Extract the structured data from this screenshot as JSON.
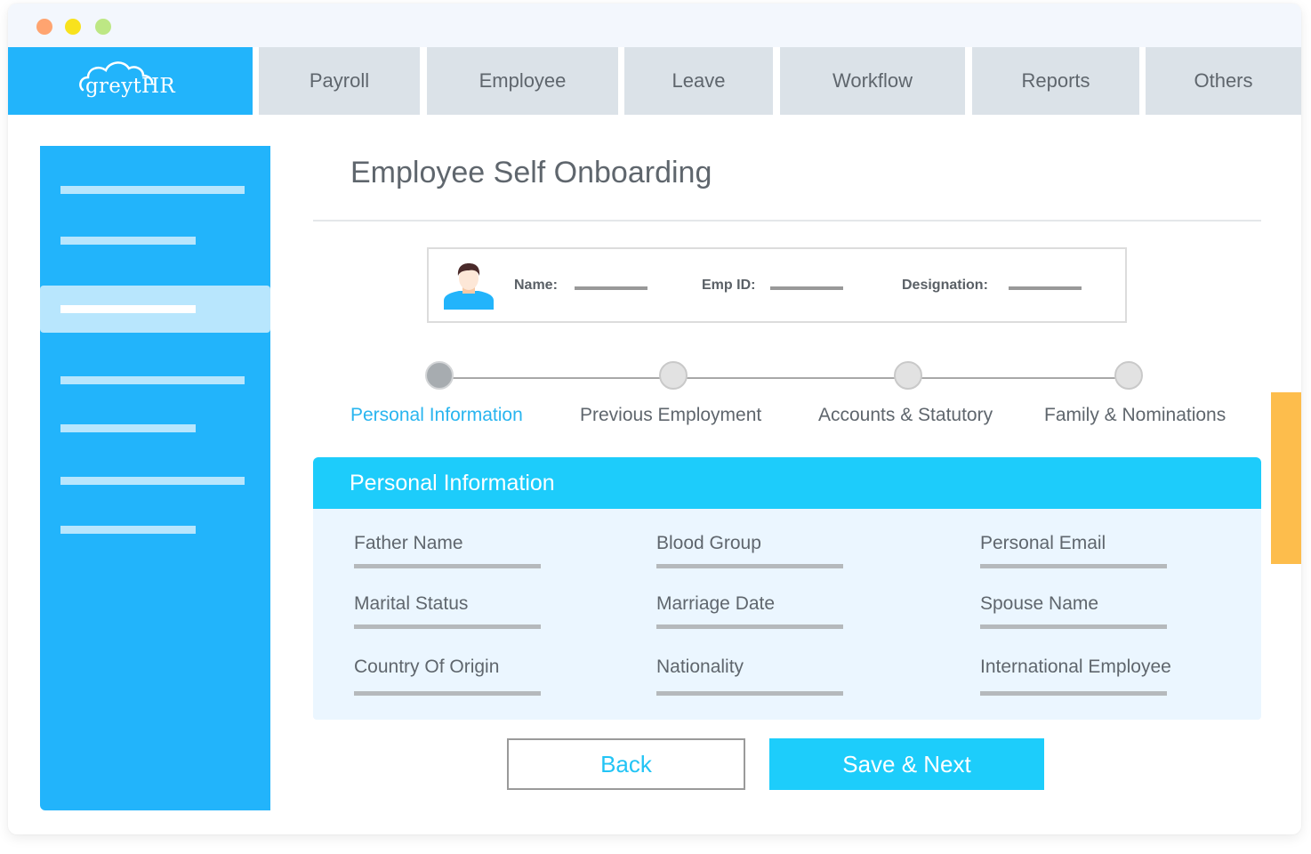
{
  "window": {
    "controls": [
      "close",
      "minimize",
      "maximize"
    ]
  },
  "brand": {
    "logo_text": "greytHR",
    "logo_icon": "cloud-icon",
    "accent_color": "#22b4fb",
    "cta_color": "#1dccfb",
    "scroll_color": "#fdbd4c"
  },
  "nav": {
    "tabs": [
      {
        "label": "Payroll"
      },
      {
        "label": "Employee"
      },
      {
        "label": "Leave"
      },
      {
        "label": "Workflow"
      },
      {
        "label": "Reports"
      },
      {
        "label": "Others"
      }
    ]
  },
  "sidebar": {
    "items": [
      {
        "placeholder": "long",
        "active": false
      },
      {
        "placeholder": "short",
        "active": false
      },
      {
        "placeholder": "short",
        "active": true
      },
      {
        "placeholder": "long",
        "active": false
      },
      {
        "placeholder": "short",
        "active": false
      },
      {
        "placeholder": "long",
        "active": false
      },
      {
        "placeholder": "short",
        "active": false
      }
    ]
  },
  "page": {
    "title": "Employee Self Onboarding"
  },
  "employee_card": {
    "avatar_icon": "user-avatar-icon",
    "name_label": "Name:",
    "emp_id_label": "Emp ID:",
    "designation_label": "Designation:"
  },
  "stepper": {
    "steps": [
      {
        "label": "Personal Information",
        "active": true
      },
      {
        "label": "Previous Employment",
        "active": false
      },
      {
        "label": "Accounts & Statutory",
        "active": false
      },
      {
        "label": "Family & Nominations",
        "active": false
      }
    ]
  },
  "personal_info": {
    "title": "Personal Information",
    "fields": [
      {
        "label": "Father Name"
      },
      {
        "label": "Blood Group"
      },
      {
        "label": "Personal Email"
      },
      {
        "label": "Marital Status"
      },
      {
        "label": "Marriage Date"
      },
      {
        "label": "Spouse Name"
      },
      {
        "label": "Country Of Origin"
      },
      {
        "label": "Nationality"
      },
      {
        "label": "International Employee"
      }
    ]
  },
  "actions": {
    "back_label": "Back",
    "save_next_label": "Save & Next"
  }
}
